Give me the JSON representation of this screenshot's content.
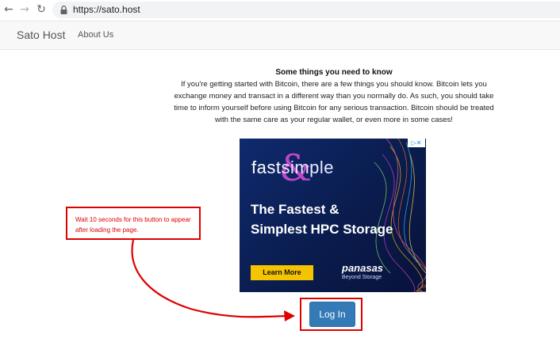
{
  "browser": {
    "url": "https://sato.host",
    "back_icon": "arrow-left-icon",
    "forward_icon": "arrow-right-icon",
    "reload_icon": "reload-icon",
    "lock_icon": "lock-icon"
  },
  "navbar": {
    "brand": "Sato Host",
    "links": [
      "About Us"
    ]
  },
  "content": {
    "heading": "Some things you need to know",
    "paragraph": "If you're getting started with Bitcoin, there are a few things you should know. Bitcoin lets you exchange money and transact in a different way than you normally do. As such, you should take time to inform yourself before using Bitcoin for any serious transaction. Bitcoin should be treated with the same care as your regular wallet, or even more in some cases!"
  },
  "ad": {
    "logo_fast": "fast",
    "logo_simple": "simple",
    "logo_amp": "&",
    "headline": "The Fastest & Simplest HPC Storage",
    "cta": "Learn More",
    "brand": "panasas",
    "tagline": "Beyond Storage",
    "choices": "▷✕"
  },
  "login": {
    "label": "Log In"
  },
  "annotation": {
    "text": "Wait 10 seconds for this button to appear after loading the page."
  },
  "colors": {
    "accent": "#337ab7",
    "annotation": "#e00000",
    "ad_background": "#0a1c4d",
    "ad_cta": "#f5c400"
  }
}
